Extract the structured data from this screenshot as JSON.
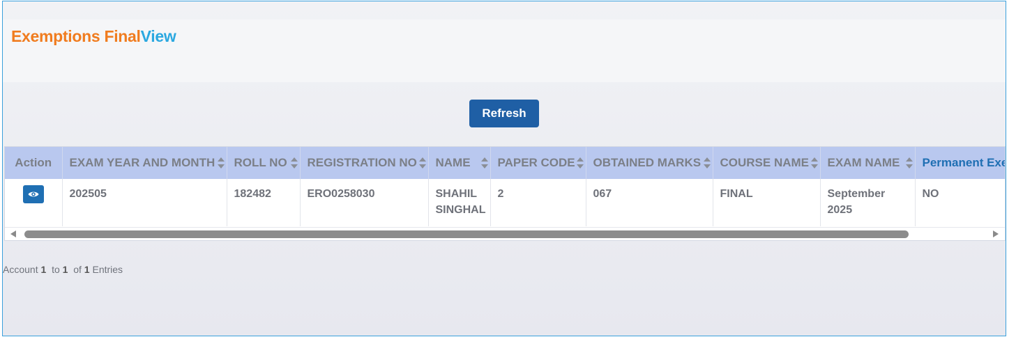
{
  "page": {
    "title_part1": "Exemptions Final",
    "title_part2": "View"
  },
  "toolbar": {
    "refresh_label": "Refresh"
  },
  "table": {
    "columns": [
      "Action",
      "EXAM YEAR AND MONTH",
      "ROLL NO",
      "REGISTRATION NO",
      "NAME",
      "PAPER CODE",
      "OBTAINED MARKS",
      "COURSE NAME",
      "EXAM NAME",
      "Permanent Exemption"
    ],
    "rows": [
      {
        "action_icon": "eye-icon",
        "exam_year_month": "202505",
        "roll_no": "182482",
        "registration_no": "ERO0258030",
        "name_line1": "SHAHIL",
        "name_line2": "SINGHAL",
        "paper_code": "2",
        "obtained_marks": "067",
        "course_name": "FINAL",
        "exam_name_line1": "September",
        "exam_name_line2": "2025",
        "permanent_exemption": "NO"
      }
    ]
  },
  "footer": {
    "prefix": "Account",
    "from": "1",
    "to_word": "to",
    "to": "1",
    "of_word": "of",
    "total": "1",
    "suffix": "Entries"
  },
  "colors": {
    "title_orange": "#f07c1f",
    "title_blue": "#2ba8e0",
    "button_blue": "#1f5fa5",
    "header_bg": "#b9c8ef"
  }
}
